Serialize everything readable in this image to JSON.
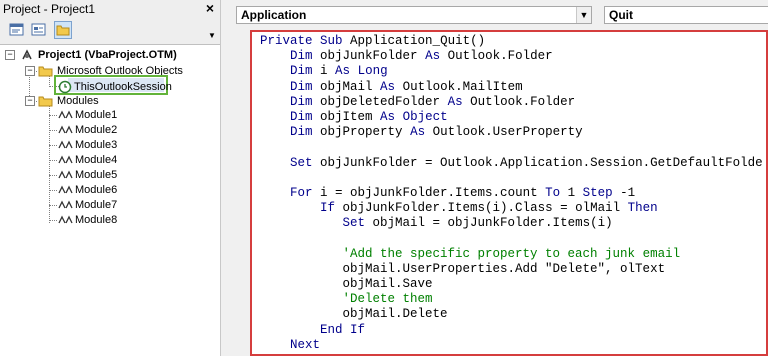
{
  "project_pane": {
    "title": "Project - Project1",
    "close_label": "×",
    "tree": {
      "project": "Project1 (VbaProject.OTM)",
      "outlook_folder": "Microsoft Outlook Objects",
      "session": "ThisOutlookSession",
      "modules_folder": "Modules",
      "modules": [
        "Module1",
        "Module2",
        "Module3",
        "Module4",
        "Module5",
        "Module6",
        "Module7",
        "Module8"
      ]
    }
  },
  "code_window": {
    "object_combo": "Application",
    "proc_combo": "Quit",
    "lines": [
      "Private Sub Application_Quit()",
      "    Dim objJunkFolder As Outlook.Folder",
      "    Dim i As Long",
      "    Dim objMail As Outlook.MailItem",
      "    Dim objDeletedFolder As Outlook.Folder",
      "    Dim objItem As Object",
      "    Dim objProperty As Outlook.UserProperty",
      "",
      "    Set objJunkFolder = Outlook.Application.Session.GetDefaultFolde",
      "",
      "    For i = objJunkFolder.Items.count To 1 Step -1",
      "        If objJunkFolder.Items(i).Class = olMail Then",
      "           Set objMail = objJunkFolder.Items(i)",
      "",
      "           'Add the specific property to each junk email",
      "           objMail.UserProperties.Add \"Delete\", olText",
      "           objMail.Save",
      "           'Delete them",
      "           objMail.Delete",
      "        End If",
      "    Next"
    ]
  },
  "colors": {
    "keyword": "#00008b",
    "comment": "#008000",
    "highlight_red": "#d53d3d",
    "highlight_green": "#62b33a"
  }
}
